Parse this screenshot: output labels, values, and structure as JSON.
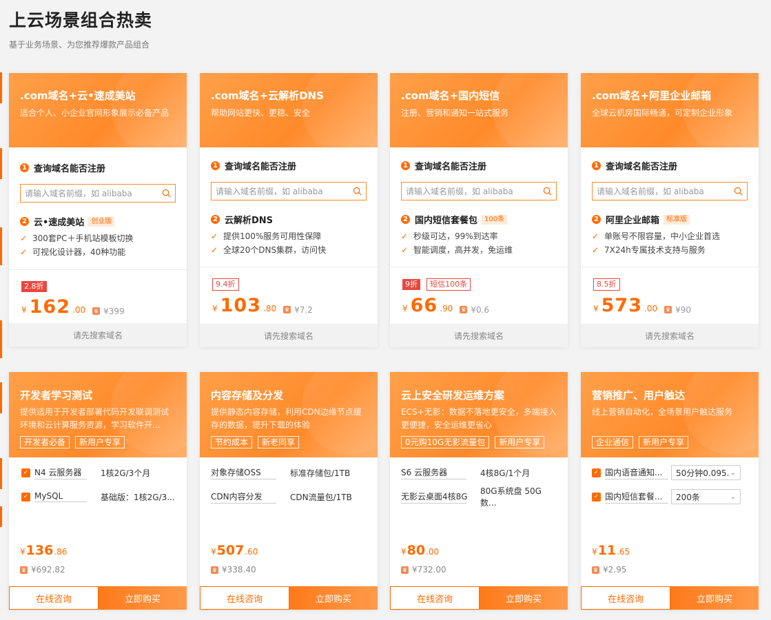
{
  "page": {
    "title": "上云场景组合热卖",
    "subtitle": "基于业务场景、为您推荐爆款产品组合"
  },
  "colors": {
    "accent": "#ff6a00",
    "discount": "#e9473e"
  },
  "row1": [
    {
      "title": ".com域名+云•速成美站",
      "desc": "适合个人、小企业官网形象展示必备产品",
      "step1": "查询域名能否注册",
      "search_placeholder": "请输入域名前缀，如 alibaba",
      "step2": "云•速成美站",
      "step2_badge": "创业版",
      "features": [
        "300套PC＋手机站模板切换",
        "可视化设计器，40种功能"
      ],
      "discount": "2.8折",
      "discount_style": "solid",
      "extra_tag": "",
      "price_int": "162",
      "price_dec": ".00",
      "orig_price": "¥399",
      "footer": "请先搜索域名"
    },
    {
      "title": ".com域名+云解析DNS",
      "desc": "帮助网站更快、更稳、安全",
      "step1": "查询域名能否注册",
      "search_placeholder": "请输入域名前缀，如 alibaba",
      "step2": "云解析DNS",
      "step2_badge": "",
      "features": [
        "提供100%服务可用性保障",
        "全球20个DNS集群，访问快"
      ],
      "discount": "9.4折",
      "discount_style": "outline",
      "extra_tag": "",
      "price_int": "103",
      "price_dec": ".80",
      "orig_price": "¥7.2",
      "footer": "请先搜索域名"
    },
    {
      "title": ".com域名+国内短信",
      "desc": "注册、营销和通知一站式服务",
      "step1": "查询域名能否注册",
      "search_placeholder": "请输入域名前缀，如 alibaba",
      "step2": "国内短信套餐包",
      "step2_badge": "100条",
      "features": [
        "秒级可达，99%到达率",
        "智能调度，高并发，免运维"
      ],
      "discount": "9折",
      "discount_style": "solid",
      "extra_tag": "短信100条",
      "price_int": "66",
      "price_dec": ".90",
      "orig_price": "¥0.6",
      "footer": "请先搜索域名"
    },
    {
      "title": ".com域名+阿里企业邮箱",
      "desc": "全球云机房国际畅通，可定制企业形象",
      "step1": "查询域名能否注册",
      "search_placeholder": "请输入域名前缀，如 alibaba",
      "step2": "阿里企业邮箱",
      "step2_badge": "标准版",
      "features": [
        "单账号不限容量，中小企业首选",
        "7X24h专属技术支持与服务"
      ],
      "discount": "8.5折",
      "discount_style": "outline",
      "extra_tag": "",
      "price_int": "573",
      "price_dec": ".00",
      "orig_price": "¥90",
      "footer": "请先搜索域名"
    }
  ],
  "row2": [
    {
      "title": "开发者学习测试",
      "desc": "提供适用于开发者部署代码开发联调测试环境和云计算服务资源，学习软件开...",
      "tags": [
        "开发者必备",
        "新用户专享"
      ],
      "products": [
        {
          "name": "N4 云服务器",
          "spec": "1核2G/3个月",
          "checkbox": true
        },
        {
          "name": "MySQL",
          "spec": "基础版：1核2G/3...",
          "checkbox": true
        }
      ],
      "price_int": "136",
      "price_dec": ".86",
      "orig_price": "¥692.82",
      "consult": "在线咨询",
      "buy": "立即购买"
    },
    {
      "title": "内容存储及分发",
      "desc": "提供静态内容存储，利用CDN边缘节点缓存的数据，提升下载的体验",
      "tags": [
        "节约成本",
        "新老同享"
      ],
      "products": [
        {
          "name": "对象存储OSS",
          "spec": "标准存储包/1TB",
          "checkbox": false
        },
        {
          "name": "CDN内容分发",
          "spec": "CDN流量包/1TB",
          "checkbox": false
        }
      ],
      "price_int": "507",
      "price_dec": ".60",
      "orig_price": "¥338.40",
      "consult": "在线咨询",
      "buy": "立即购买"
    },
    {
      "title": "云上安全研发运维方案",
      "desc": "ECS+无影：数据不落地更安全，多端接入更便捷，安全运维更省心",
      "tags": [
        "0元购10G无影流量包",
        "新用户专享"
      ],
      "products": [
        {
          "name": "S6 云服务器",
          "spec": "4核8G/1个月",
          "checkbox": false
        },
        {
          "name": "无影云桌面4核8G",
          "spec": "80G系统盘 50G数...",
          "checkbox": false
        }
      ],
      "price_int": "80",
      "price_dec": ".00",
      "orig_price": "¥732.00",
      "consult": "在线咨询",
      "buy": "立即购买"
    },
    {
      "title": "营销推广、用户触达",
      "desc": "线上营销自动化，全场景用户触达服务",
      "tags": [
        "企业通信",
        "新用户专享"
      ],
      "products": [
        {
          "name": "国内语音通知...",
          "select": "50分钟0.095...",
          "checkbox": true
        },
        {
          "name": "国内短信套餐...",
          "select": "200条",
          "checkbox": true
        }
      ],
      "price_int": "11",
      "price_dec": ".65",
      "orig_price": "¥2.95",
      "consult": "在线咨询",
      "buy": "立即购买"
    }
  ]
}
